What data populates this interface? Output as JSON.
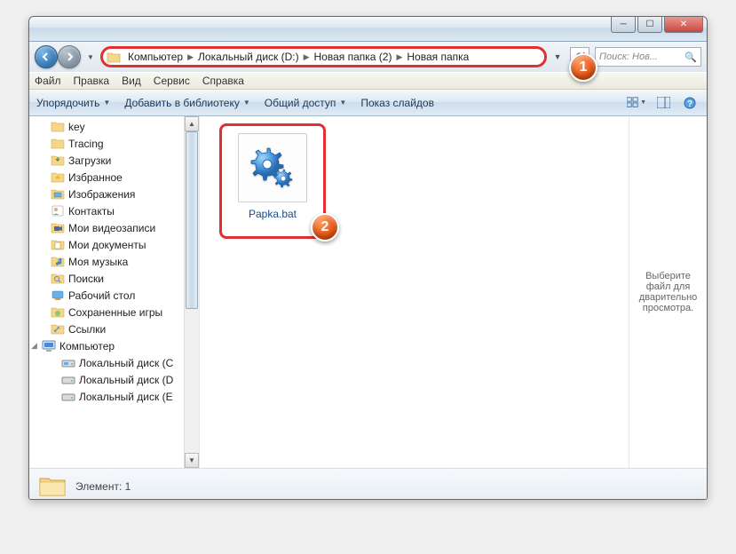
{
  "breadcrumb": {
    "seg0": "Компьютер",
    "seg1": "Локальный диск (D:)",
    "seg2": "Новая папка (2)",
    "seg3": "Новая папка"
  },
  "search": {
    "placeholder": "Поиск: Нов..."
  },
  "menu": {
    "file": "Файл",
    "edit": "Правка",
    "view": "Вид",
    "tools": "Сервис",
    "help": "Справка"
  },
  "toolbar": {
    "organize": "Упорядочить",
    "addlib": "Добавить в библиотеку",
    "share": "Общий доступ",
    "slideshow": "Показ слайдов"
  },
  "tree": {
    "t0": "key",
    "t1": "Tracing",
    "t2": "Загрузки",
    "t3": "Избранное",
    "t4": "Изображения",
    "t5": "Контакты",
    "t6": "Мои видеозаписи",
    "t7": "Мои документы",
    "t8": "Моя музыка",
    "t9": "Поиски",
    "t10": "Рабочий стол",
    "t11": "Сохраненные игры",
    "t12": "Ссылки",
    "t13": "Компьютер",
    "t14": "Локальный диск (C",
    "t15": "Локальный диск (D",
    "t16": "Локальный диск (E"
  },
  "file": {
    "name": "Papka.bat"
  },
  "preview": {
    "text": "Выберите файл для дварительно просмотра."
  },
  "status": {
    "text": "Элемент: 1"
  },
  "callouts": {
    "c1": "1",
    "c2": "2"
  }
}
